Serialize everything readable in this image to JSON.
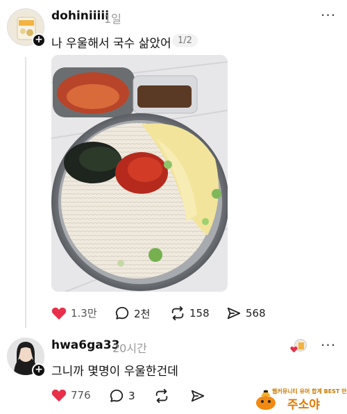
{
  "post": {
    "username": "dohiniiiii",
    "time": "1일",
    "text": "나 우울해서 국수 삶았어",
    "image_counter": "1/2",
    "more_icon": "more-dots-icon",
    "actions": {
      "likes": "1.3만",
      "comments": "2천",
      "reposts": "158",
      "shares": "568"
    }
  },
  "reply": {
    "username": "hwa6ga33",
    "time": "20시간",
    "text": "그니까 몇명이 우울한건데",
    "actions": {
      "likes": "776",
      "comments": "3"
    }
  },
  "watermark": {
    "top_text": "웹커뮤니티 유머 합계 BEST 만큼",
    "main_text": "주소야"
  },
  "colors": {
    "heart": "#e8304a",
    "text": "#111111",
    "muted": "#999999",
    "watermark": "#e07800"
  }
}
